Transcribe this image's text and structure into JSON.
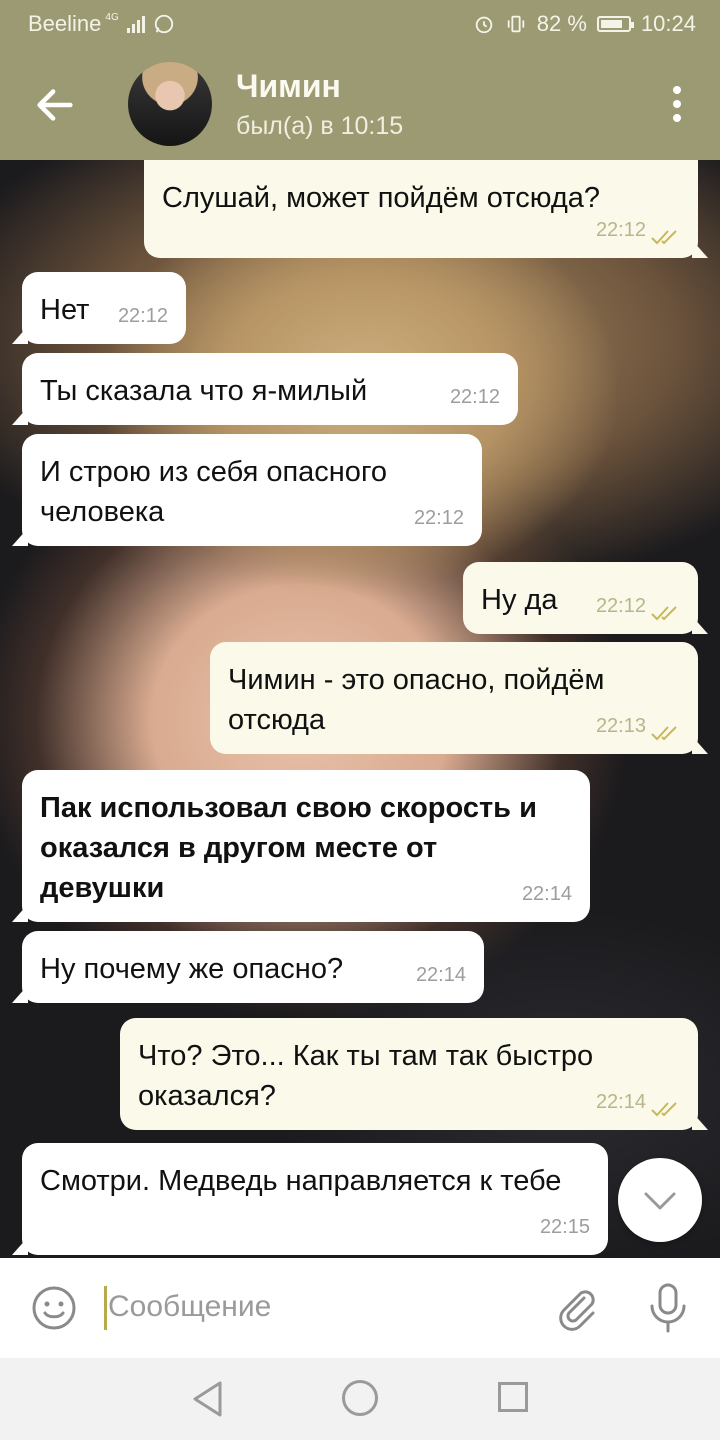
{
  "status_bar": {
    "carrier": "Beeline",
    "network": "4G",
    "battery": "82 %",
    "battery_level": 0.82,
    "time": "10:24"
  },
  "header": {
    "name": "Чимин",
    "status": "был(а) в 10:15"
  },
  "messages": [
    {
      "dir": "out",
      "text": "Слушай, может пойдём отсюда?",
      "time": "22:12",
      "read": true
    },
    {
      "dir": "in",
      "text": "Нет",
      "time": "22:12"
    },
    {
      "dir": "in",
      "text": "Ты сказала что я-милый",
      "time": "22:12"
    },
    {
      "dir": "in",
      "text": "И строю из себя опасного человека",
      "time": "22:12"
    },
    {
      "dir": "out",
      "text": "Ну да",
      "time": "22:12",
      "read": true
    },
    {
      "dir": "out",
      "text": "Чимин - это опасно, пойдём отсюда",
      "time": "22:13",
      "read": true
    },
    {
      "dir": "in",
      "text": "Пак использовал свою скорость и оказался в другом месте от девушки",
      "time": "22:14",
      "bold": true
    },
    {
      "dir": "in",
      "text": "Ну почему же опасно?",
      "time": "22:14"
    },
    {
      "dir": "out",
      "text": "Что? Это... Как ты там так быстро оказался?",
      "time": "22:14",
      "read": true
    },
    {
      "dir": "in",
      "text": "Смотри. Медведь направляется к тебе",
      "time": "22:15"
    }
  ],
  "input": {
    "placeholder": "Сообщение"
  },
  "colors": {
    "header": "#9b9a72",
    "outgoing_bubble": "#fbf9ea",
    "incoming_bubble": "#ffffff",
    "read_check": "#c9b85a"
  },
  "icons": [
    "back-arrow-icon",
    "more-vert-icon",
    "emoji-icon",
    "attach-icon",
    "mic-icon",
    "chevron-down-icon",
    "double-check-icon"
  ]
}
